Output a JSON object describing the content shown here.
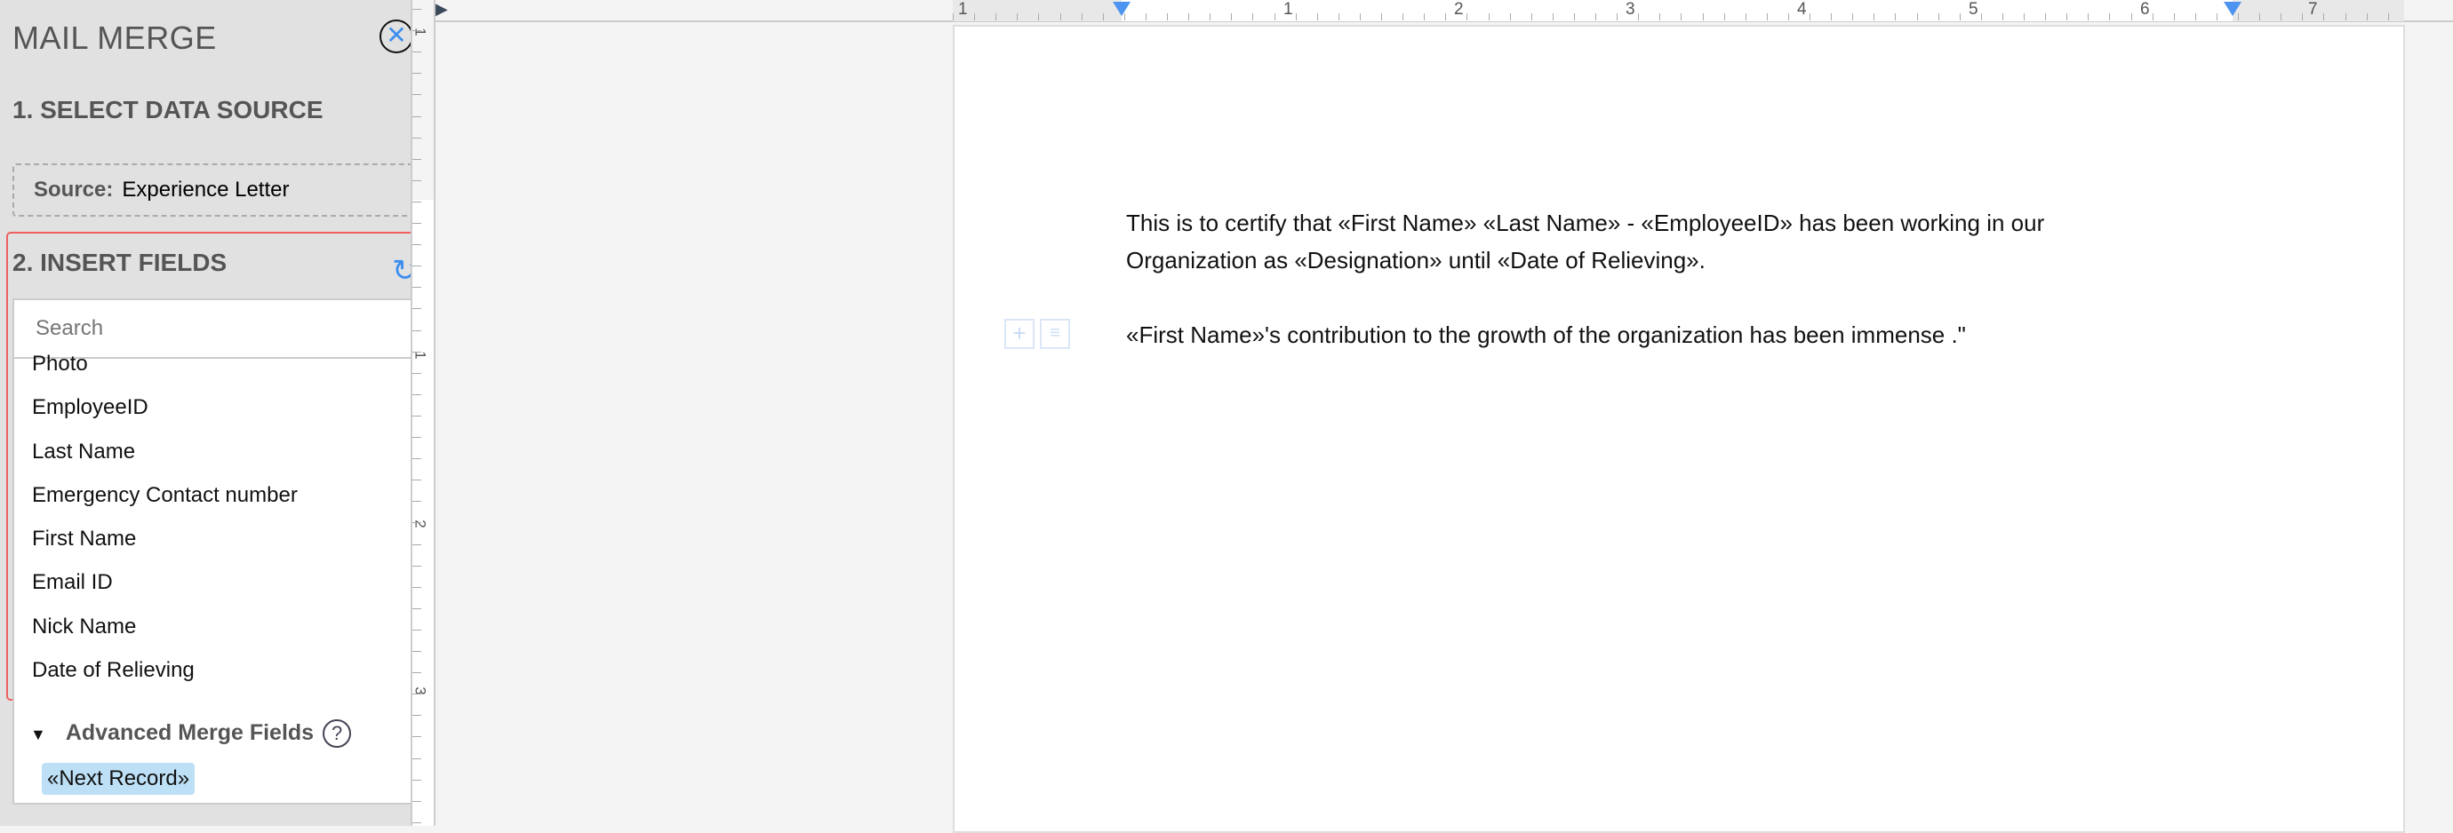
{
  "sidebar": {
    "title": "MAIL MERGE",
    "close_icon": "close-icon",
    "step1": "1. SELECT DATA SOURCE",
    "source_label": "Source:",
    "source_value": "Experience Letter",
    "step2": "2. INSERT FIELDS",
    "search_placeholder": "Search",
    "fields": [
      "Photo",
      "EmployeeID",
      "Last Name",
      "Emergency Contact number",
      "First Name",
      "Email ID",
      "Nick Name",
      "Date of Relieving"
    ],
    "advanced_label": "Advanced Merge Fields",
    "help": "?",
    "next_record": "«Next Record»"
  },
  "ruler": {
    "h_labels": [
      "1",
      "1",
      "2",
      "3",
      "4",
      "5",
      "6",
      "7"
    ],
    "v_labels": [
      "1",
      "1",
      "2",
      "3"
    ]
  },
  "document": {
    "paragraphs": [
      "This is to certify that «First Name» «Last Name» - «EmployeeID» has been working in our Organization as «Designation» until «Date of Relieving».",
      "«First Name»'s contribution to the growth of the organization has been immense .\""
    ]
  },
  "colors": {
    "accent": "#3d8ef0",
    "highlight_border": "#f06060",
    "chip": "#bde0f6"
  }
}
